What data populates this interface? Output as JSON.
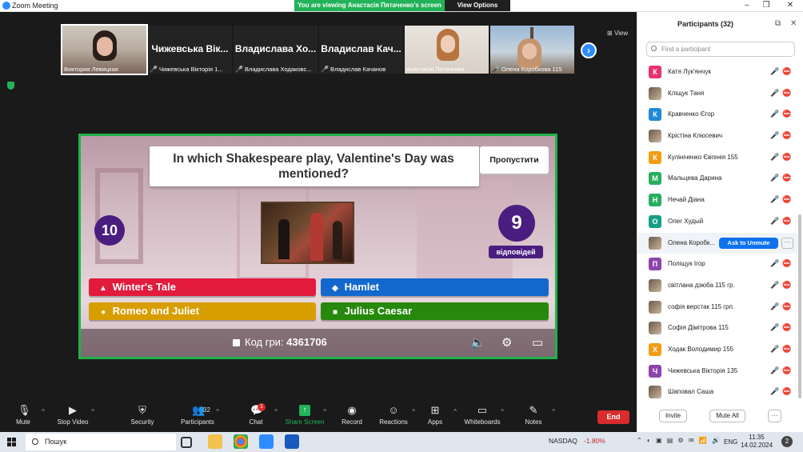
{
  "window": {
    "title": "Zoom Meeting",
    "minimize": "–",
    "maximize": "❐",
    "close": "✕"
  },
  "banner": {
    "viewing": "You are viewing Анастасія Пятаченко's screen",
    "view_options": "View Options"
  },
  "gallery": {
    "tiles": [
      {
        "big": "",
        "label": "Виктория Левицкая",
        "muted": false
      },
      {
        "big": "Чижевська Вік...",
        "label": "Чижевська Вікторія 1...",
        "muted": true
      },
      {
        "big": "Владислава Хо...",
        "label": "Владислава Ходаковс...",
        "muted": true
      },
      {
        "big": "Владислав Кач...",
        "label": "Владислав Качанов",
        "muted": true
      },
      {
        "big": "",
        "label": "Анастасія Пятаченко",
        "muted": false
      },
      {
        "big": "",
        "label": "Олена Коробкова 115",
        "muted": true
      }
    ],
    "next_icon": "›",
    "view_label": "View"
  },
  "game": {
    "question": "In which Shakespeare play, Valentine's Day was mentioned?",
    "skip": "Пропустити",
    "timer": "10",
    "answers_count": "9",
    "answers_label": "відповідей",
    "answers": [
      {
        "symbol": "▲",
        "text": "Winter's Tale",
        "color": "#e21b3c"
      },
      {
        "symbol": "◆",
        "text": "Hamlet",
        "color": "#1368ce"
      },
      {
        "symbol": "●",
        "text": "Romeo and Juliet",
        "color": "#d89e00"
      },
      {
        "symbol": "■",
        "text": "Julius Caesar",
        "color": "#26890c"
      }
    ],
    "code_label": "Код гри: ",
    "code_value": "4361706",
    "volume_icon": "🔈",
    "settings_icon": "⚙",
    "cast_icon": "▭"
  },
  "toolbar": {
    "mute": "Mute",
    "stop_video": "Stop Video",
    "security": "Security",
    "participants": "Participants",
    "participants_count": "32",
    "chat": "Chat",
    "chat_badge": "1",
    "share_screen": "Share Screen",
    "record": "Record",
    "reactions": "Reactions",
    "apps": "Apps",
    "whiteboards": "Whiteboards",
    "notes": "Notes",
    "end": "End"
  },
  "panel": {
    "title": "Participants (32)",
    "search_placeholder": "Find a participant",
    "participants": [
      {
        "initial": "К",
        "color": "#e5336b",
        "name": "Катя Лук'янчук",
        "photo": false
      },
      {
        "initial": "",
        "color": "",
        "name": "Кліщук Таня",
        "photo": true
      },
      {
        "initial": "К",
        "color": "#1f8ad6",
        "name": "Кравченко Єгор",
        "photo": false
      },
      {
        "initial": "",
        "color": "",
        "name": "Крістіна Клюсевич",
        "photo": true
      },
      {
        "initial": "К",
        "color": "#f39c12",
        "name": "Кулініченко Євгенія 155",
        "photo": false
      },
      {
        "initial": "М",
        "color": "#27ae60",
        "name": "Мальцева Дарина",
        "photo": false
      },
      {
        "initial": "Н",
        "color": "#27ae60",
        "name": "Нечай Діана",
        "photo": false
      },
      {
        "initial": "О",
        "color": "#16a085",
        "name": "Олег Худый",
        "photo": false
      },
      {
        "initial": "",
        "color": "",
        "name": "Олена Коробк...",
        "photo": true,
        "highlight": true
      },
      {
        "initial": "П",
        "color": "#8e44ad",
        "name": "Поліщук Ігор",
        "photo": false
      },
      {
        "initial": "",
        "color": "",
        "name": "світлана дзюба 115 гр.",
        "photo": true
      },
      {
        "initial": "",
        "color": "",
        "name": "софія верстак 115 грп.",
        "photo": true
      },
      {
        "initial": "",
        "color": "",
        "name": "Софія Дімітрова 115",
        "photo": true
      },
      {
        "initial": "Х",
        "color": "#f39c12",
        "name": "Ходак Володимир 155",
        "photo": false
      },
      {
        "initial": "Ч",
        "color": "#8e44ad",
        "name": "Чижевська Вікторія 135",
        "photo": false
      },
      {
        "initial": "",
        "color": "",
        "name": "Шаповал Саша",
        "photo": true
      }
    ],
    "ask_to_unmute": "Ask to Unmute",
    "more": "···",
    "invite": "Invite",
    "mute_all": "Mute All",
    "footer_more": "···"
  },
  "taskbar": {
    "search": "Пошук",
    "stock_name": "NASDAQ",
    "stock_change": "-1.80%",
    "language": "ENG",
    "time": "11:35",
    "date": "14.02.2024",
    "notifications": "2"
  }
}
